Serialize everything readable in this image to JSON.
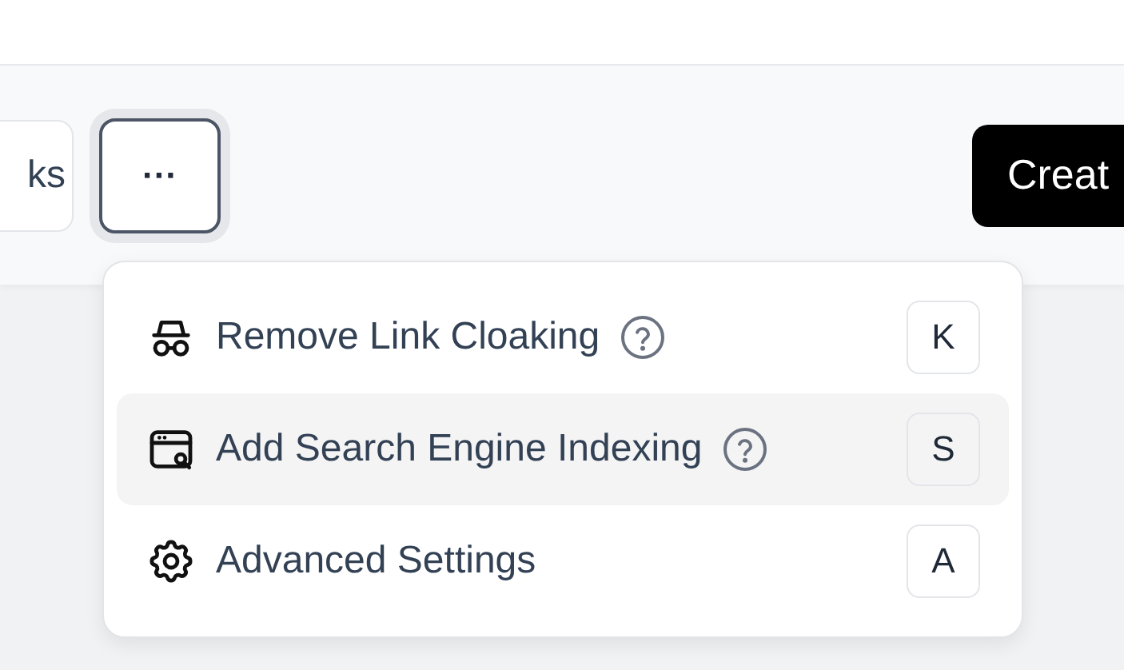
{
  "toolbar": {
    "partial_button": "ks",
    "more_button": {
      "label": "···",
      "focused": true
    },
    "create_button": "Creat"
  },
  "menu": {
    "items": [
      {
        "kind": "spy",
        "label": "Remove Link Cloaking",
        "help": true,
        "shortcut": "K",
        "highlighted": false
      },
      {
        "kind": "browser-search",
        "label": "Add Search Engine Indexing",
        "help": true,
        "shortcut": "S",
        "highlighted": true
      },
      {
        "kind": "gear",
        "label": "Advanced Settings",
        "help": false,
        "shortcut": "A",
        "highlighted": false
      }
    ]
  }
}
